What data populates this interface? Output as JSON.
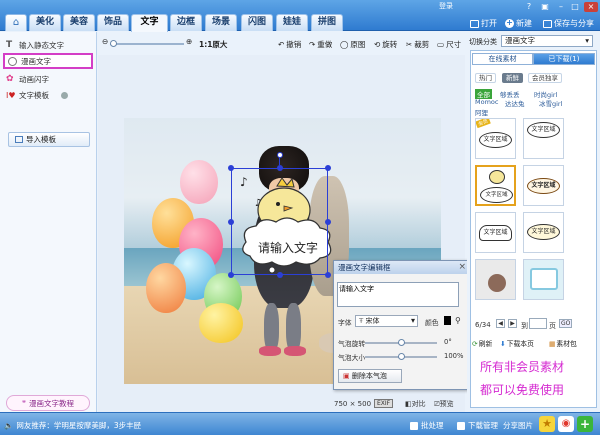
{
  "nav": {
    "tabs": [
      "美化",
      "美容",
      "饰品",
      "文字",
      "边框",
      "场景",
      "闪图",
      "娃娃",
      "拼图"
    ],
    "active_tab": "文字"
  },
  "title_bar": {
    "user_label": "登录",
    "open_label": "打开",
    "new_label": "新建",
    "save_label": "保存与分享"
  },
  "left_panel": {
    "items": [
      {
        "label": "输入静态文字",
        "icon": "text-t-icon"
      },
      {
        "label": "漫画文字",
        "icon": "comic-bubble-icon",
        "selected": true
      },
      {
        "label": "动画闪字",
        "icon": "sparkle-icon"
      },
      {
        "label": "文字模板",
        "icon": "template-icon",
        "badge": "new-icon"
      }
    ],
    "import_label": "导入模板",
    "tutorial_label": "漫画文字教程"
  },
  "toolbar": {
    "actual_size": "1:1原大",
    "undo": "撤销",
    "redo": "重做",
    "original": "原图",
    "rotate": "旋转",
    "crop": "裁剪",
    "resize": "尺寸"
  },
  "canvas": {
    "bubble_text": "请输入文字"
  },
  "editor_dialog": {
    "title": "漫画文字编辑框",
    "text_value": "请输入文字",
    "font_label": "字体",
    "font_value": "宋体",
    "color_label": "颜色",
    "rotate_label": "气泡旋转",
    "rotate_value": "0°",
    "size_label": "气泡大小",
    "size_value": "100%",
    "delete_label": "删除本气泡"
  },
  "canvas_status": {
    "dims": "750 × 500",
    "exif": "EXIF",
    "compare": "对比",
    "preview": "预览"
  },
  "right_panel": {
    "switch_label": "切换分类",
    "category": "漫画文字",
    "tab_online": "在线素材",
    "tab_downloaded": "已下载(1)",
    "filters": [
      "热门",
      "新鲜",
      "会员独享"
    ],
    "filter_active": "新鲜",
    "categories_row1": [
      "全部",
      "够丢丢",
      "时尚girl"
    ],
    "categories_row2": [
      "Momoc",
      "达达兔",
      "冰雪girl"
    ],
    "categories_row3": [
      "阿狸"
    ],
    "thumbs": [
      {
        "text": "文字区域",
        "badge": "会员"
      },
      {
        "text": "文字区域"
      },
      {
        "text": "文字区域"
      },
      {
        "text": "文字区域"
      },
      {
        "text": "文字区域"
      },
      {
        "text": "文字区域"
      },
      {
        "text": ""
      },
      {
        "text": ""
      }
    ],
    "page": "6/34",
    "goto_label": "到",
    "page_unit": "页",
    "go": "GO",
    "refresh": "刷新",
    "download_page": "下载本页",
    "material_pack": "素材包",
    "promo_line1": "所有非会员素材",
    "promo_line2": "都可以免费使用"
  },
  "status_bar": {
    "tip": "网友推荐：学明星按摩美脚，3步丰胫",
    "batch": "批处理",
    "download_mgr": "下载管理",
    "share": "分享图片"
  }
}
